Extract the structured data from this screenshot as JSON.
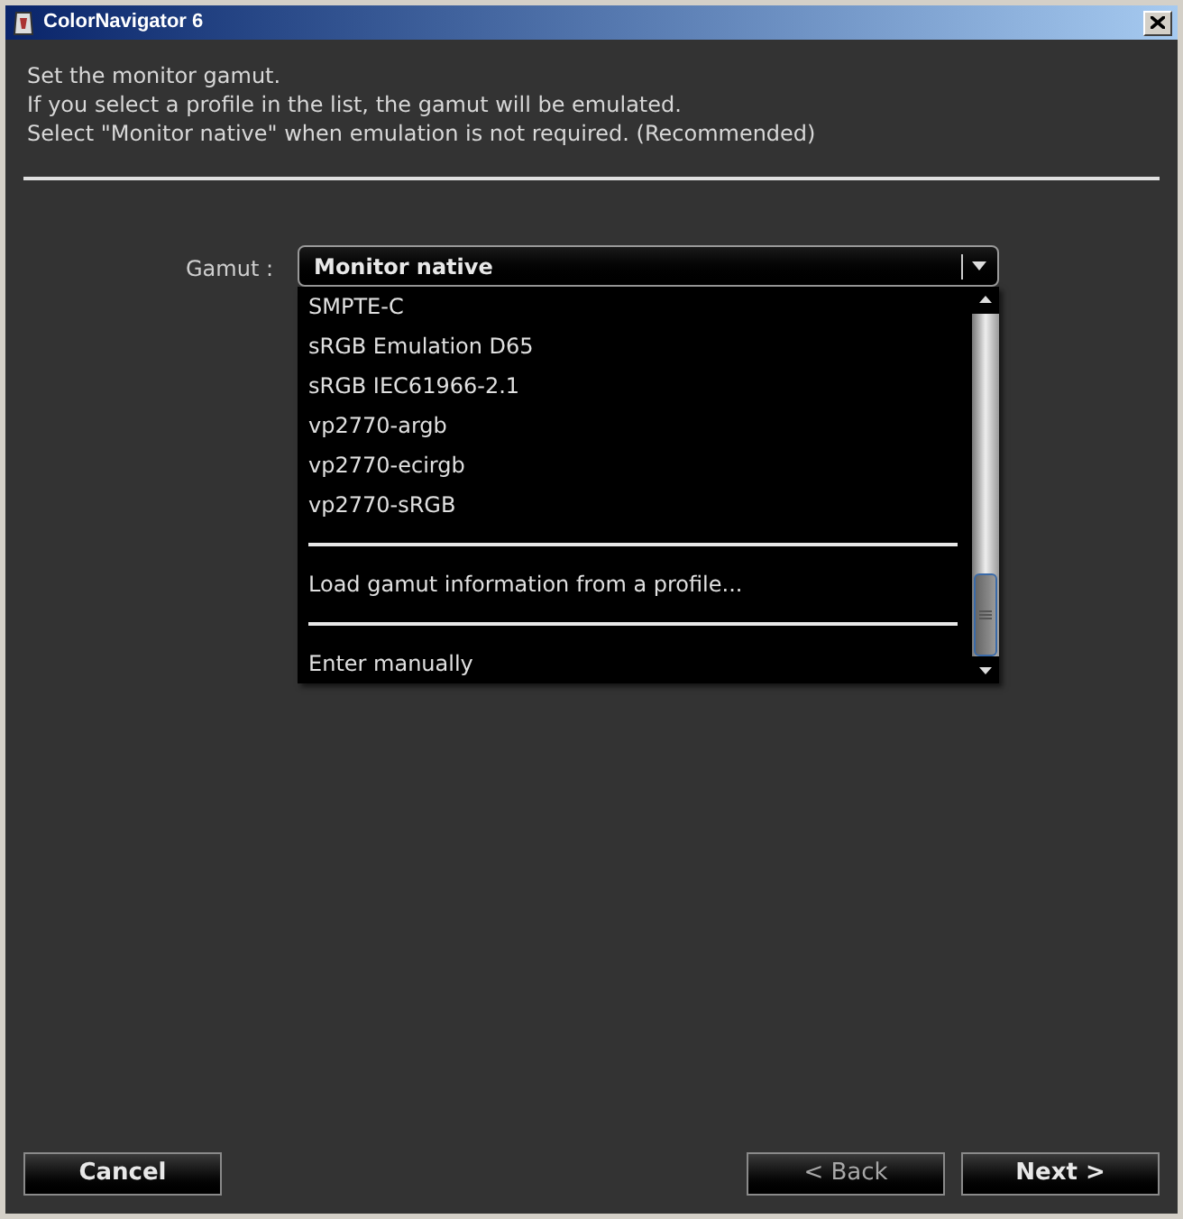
{
  "window": {
    "title": "ColorNavigator 6"
  },
  "instructions": [
    "Set the monitor gamut.",
    "If you select a profile in the list, the gamut will be emulated.",
    "Select \"Monitor native\" when emulation is not required. (Recommended)"
  ],
  "gamut": {
    "label": "Gamut :",
    "value": "Monitor native",
    "options": [
      {
        "kind": "option",
        "label": "SMPTE-C"
      },
      {
        "kind": "option",
        "label": "sRGB Emulation D65"
      },
      {
        "kind": "option",
        "label": "sRGB IEC61966-2.1"
      },
      {
        "kind": "option",
        "label": "vp2770-argb"
      },
      {
        "kind": "option",
        "label": "vp2770-ecirgb"
      },
      {
        "kind": "option",
        "label": "vp2770-sRGB"
      },
      {
        "kind": "separator"
      },
      {
        "kind": "option",
        "label": "Load gamut information from a profile..."
      },
      {
        "kind": "separator"
      },
      {
        "kind": "option",
        "label": "Enter manually"
      }
    ]
  },
  "buttons": [
    {
      "label": "Cancel",
      "disabled": false
    },
    {
      "label": "< Back",
      "disabled": true
    },
    {
      "label": "Next >",
      "disabled": false
    }
  ]
}
